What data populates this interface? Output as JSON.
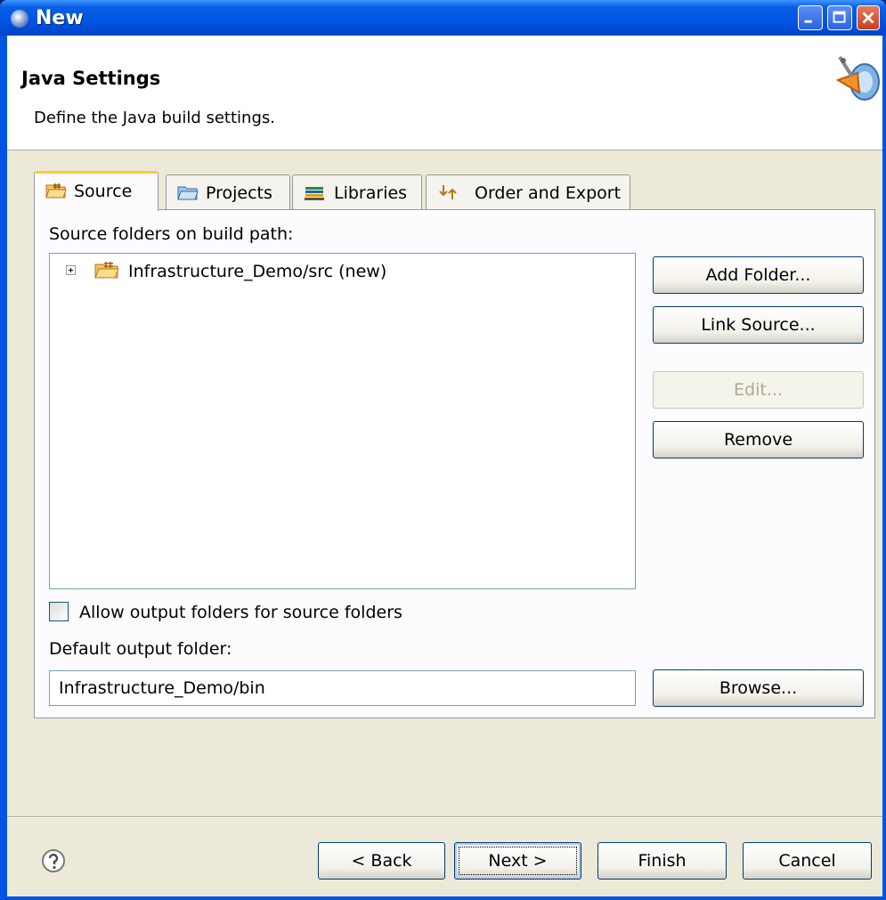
{
  "window": {
    "title": "New",
    "controls": {
      "minimize": "minimize",
      "maximize": "maximize",
      "close": "close"
    }
  },
  "header": {
    "title": "Java Settings",
    "description": "Define the Java build settings."
  },
  "tabs": [
    {
      "label": "Source",
      "icon": "source-folder-icon",
      "active": true
    },
    {
      "label": "Projects",
      "icon": "projects-folder-icon",
      "active": false
    },
    {
      "label": "Libraries",
      "icon": "libraries-icon",
      "active": false
    },
    {
      "label": "Order and Export",
      "icon": "order-export-icon",
      "active": false
    }
  ],
  "source_tab": {
    "tree_label": "Source folders on build path:",
    "tree_items": [
      {
        "label": "Infrastructure_Demo/src (new)",
        "expanded": false
      }
    ],
    "buttons": {
      "add_folder": "Add Folder...",
      "link_source": "Link Source...",
      "edit": "Edit...",
      "remove": "Remove"
    },
    "allow_output_label": "Allow output folders for source folders",
    "allow_output_checked": false,
    "default_output_label": "Default output folder:",
    "default_output_value": "Infrastructure_Demo/bin",
    "browse": "Browse..."
  },
  "footer": {
    "back": "< Back",
    "next": "Next >",
    "finish": "Finish",
    "cancel": "Cancel"
  },
  "colors": {
    "title_bar": "#0054e3",
    "dialog_bg": "#ece9d8",
    "active_tab_accent": "#ffc83c"
  }
}
